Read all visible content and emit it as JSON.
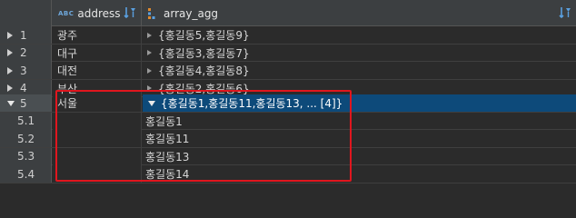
{
  "columns": {
    "address": {
      "type_badge": "ABC",
      "label": "address",
      "sort_icon": "sort-filter-icon"
    },
    "array_agg": {
      "type_icon": "array-type-icon",
      "label": "array_agg",
      "sort_icon": "sort-filter-icon"
    }
  },
  "rows": [
    {
      "num": "1",
      "address": "광주",
      "array_agg": "{홍길동5,홍길동9}"
    },
    {
      "num": "2",
      "address": "대구",
      "array_agg": "{홍길동3,홍길동7}"
    },
    {
      "num": "3",
      "address": "대전",
      "array_agg": "{홍길동4,홍길동8}"
    },
    {
      "num": "4",
      "address": "부산",
      "array_agg": "{홍길동2,홍길동6}"
    },
    {
      "num": "5",
      "address": "서울",
      "array_agg": "{홍길동1,홍길동11,홍길동13, ... [4]}"
    }
  ],
  "expanded_items": [
    {
      "num": "5.1",
      "value": "홍길동1"
    },
    {
      "num": "5.2",
      "value": "홍길동11"
    },
    {
      "num": "5.3",
      "value": "홍길동13"
    },
    {
      "num": "5.4",
      "value": "홍길동14"
    }
  ],
  "colors": {
    "selection": "#0d4a7a",
    "highlight_box": "#e0161e",
    "header_bg": "#3c3f41",
    "grid_bg": "#2b2b2b"
  }
}
